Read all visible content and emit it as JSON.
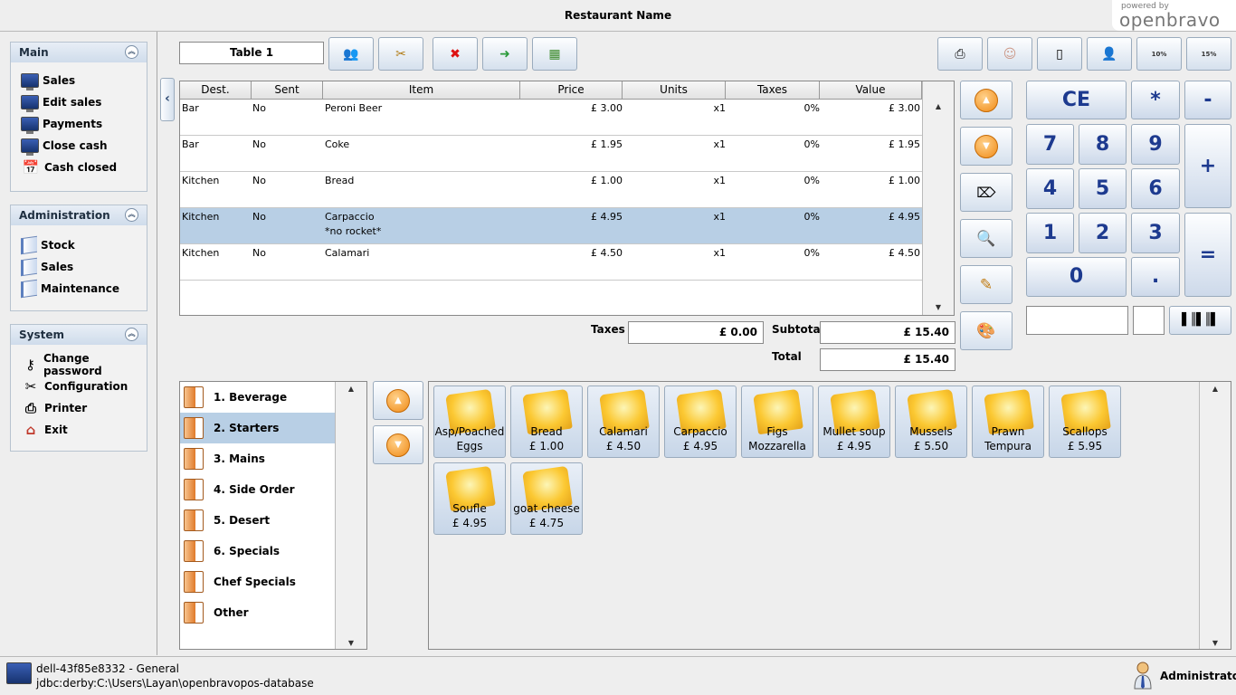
{
  "window": {
    "title": "Restaurant Name"
  },
  "logo": {
    "powered": "powered by",
    "brand": "openbravo"
  },
  "menu": {
    "main": {
      "title": "Main",
      "items": [
        "Sales",
        "Edit sales",
        "Payments",
        "Close cash",
        "Cash closed"
      ]
    },
    "administration": {
      "title": "Administration",
      "items": [
        "Stock",
        "Sales",
        "Maintenance"
      ]
    },
    "system": {
      "title": "System",
      "items": [
        "Change password",
        "Configuration",
        "Printer",
        "Exit"
      ]
    }
  },
  "toolbar": {
    "table_label": "Table 1",
    "discount_10": "10%",
    "discount_15": "15%"
  },
  "ticket": {
    "columns": [
      "Dest.",
      "Sent",
      "Item",
      "Price",
      "Units",
      "Taxes",
      "Value"
    ],
    "rows": [
      {
        "dest": "Bar",
        "sent": "No",
        "item": "Peroni Beer",
        "note": "",
        "price": "£ 3.00",
        "units": "x1",
        "taxes": "0%",
        "value": "£ 3.00"
      },
      {
        "dest": "Bar",
        "sent": "No",
        "item": "Coke",
        "note": "",
        "price": "£ 1.95",
        "units": "x1",
        "taxes": "0%",
        "value": "£ 1.95"
      },
      {
        "dest": "Kitchen",
        "sent": "No",
        "item": "Bread",
        "note": "",
        "price": "£ 1.00",
        "units": "x1",
        "taxes": "0%",
        "value": "£ 1.00"
      },
      {
        "dest": "Kitchen",
        "sent": "No",
        "item": "Carpaccio",
        "note": "*no rocket*",
        "price": "£ 4.95",
        "units": "x1",
        "taxes": "0%",
        "value": "£ 4.95"
      },
      {
        "dest": "Kitchen",
        "sent": "No",
        "item": "Calamari",
        "note": "",
        "price": "£ 4.50",
        "units": "x1",
        "taxes": "0%",
        "value": "£ 4.50"
      }
    ]
  },
  "totals": {
    "taxes_label": "Taxes",
    "taxes": "£ 0.00",
    "subtotal_label": "Subtotal",
    "subtotal": "£ 15.40",
    "total_label": "Total",
    "total": "£ 15.40"
  },
  "keypad": {
    "ce": "CE",
    "multiply": "*",
    "minus": "-",
    "plus": "+",
    "equals": "=",
    "n7": "7",
    "n8": "8",
    "n9": "9",
    "n4": "4",
    "n5": "5",
    "n6": "6",
    "n1": "1",
    "n2": "2",
    "n3": "3",
    "n0": "0",
    "dot": "."
  },
  "categories": [
    "1. Beverage",
    "2. Starters",
    "3. Mains",
    "4. Side Order",
    "5. Desert",
    "6. Specials",
    "Chef Specials",
    "Other"
  ],
  "products": [
    {
      "name": "Asp/Poached",
      "name2": "Eggs",
      "price": ""
    },
    {
      "name": "Bread",
      "name2": "",
      "price": "£ 1.00"
    },
    {
      "name": "Calamari",
      "name2": "",
      "price": "£ 4.50"
    },
    {
      "name": "Carpaccio",
      "name2": "",
      "price": "£ 4.95"
    },
    {
      "name": "Figs",
      "name2": "Mozzarella",
      "price": ""
    },
    {
      "name": "Mullet soup",
      "name2": "",
      "price": "£ 4.95"
    },
    {
      "name": "Mussels",
      "name2": "",
      "price": "£ 5.50"
    },
    {
      "name": "Prawn",
      "name2": "Tempura",
      "price": ""
    },
    {
      "name": "Scallops",
      "name2": "",
      "price": "£ 5.95"
    },
    {
      "name": "Soufle",
      "name2": "",
      "price": "£ 4.95"
    },
    {
      "name": "goat cheese",
      "name2": "",
      "price": "£ 4.75"
    }
  ],
  "status": {
    "host": "dell-43f85e8332 - General",
    "db": "jdbc:derby:C:\\Users\\Layan\\openbravopos-database",
    "user": "Administrator"
  }
}
